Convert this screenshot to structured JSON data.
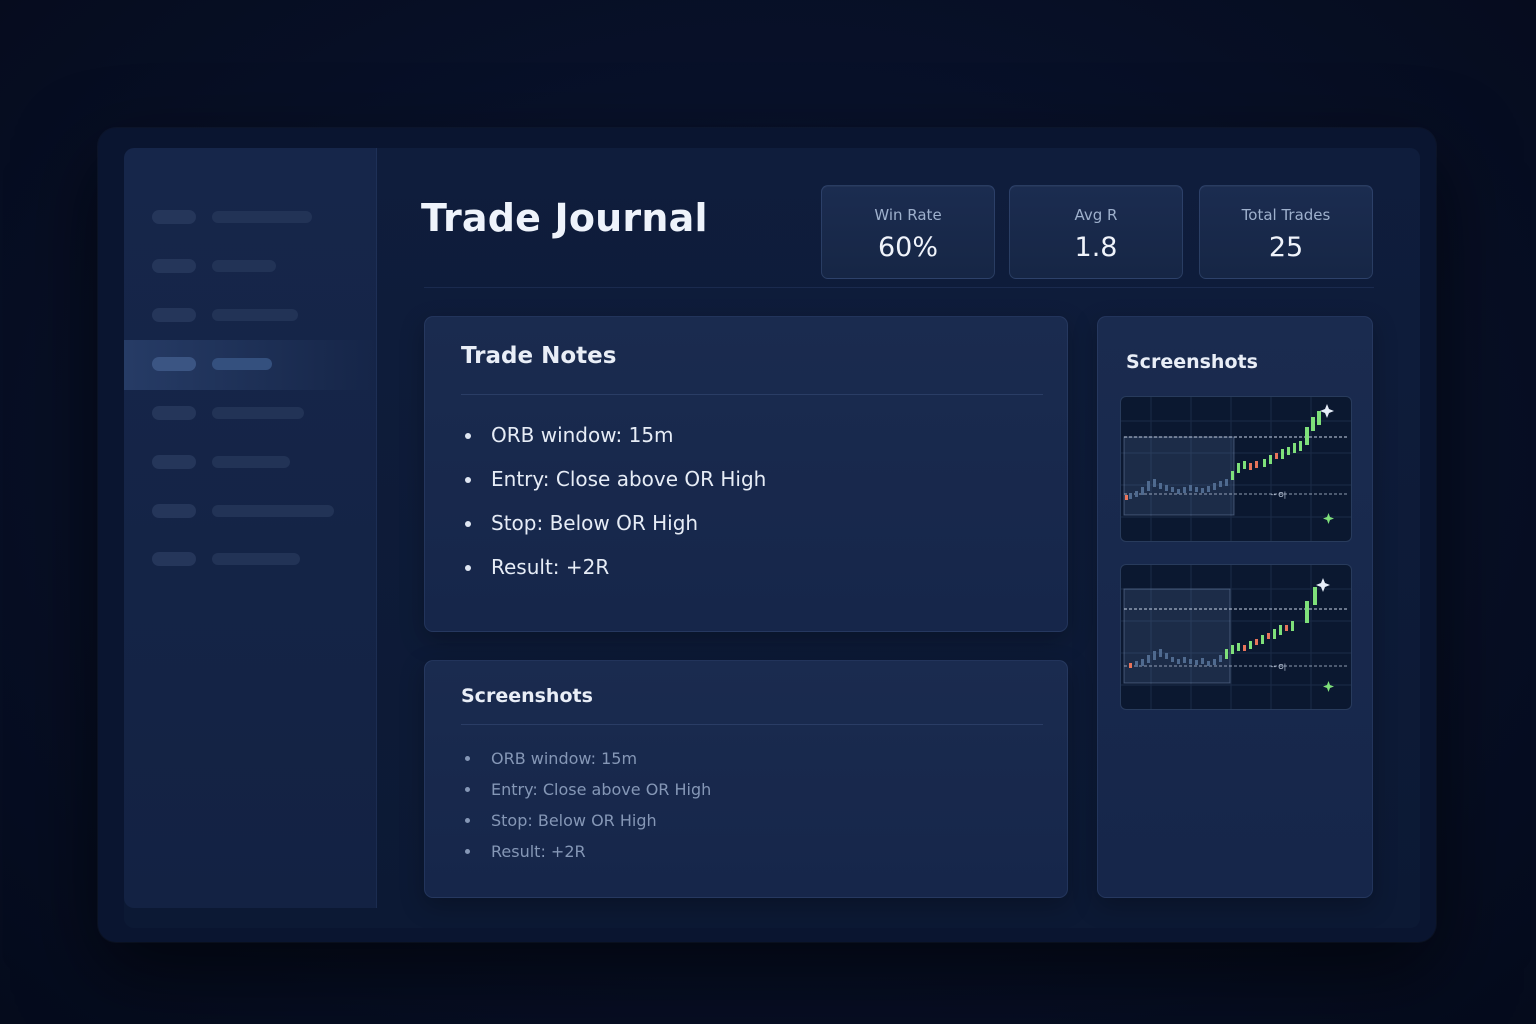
{
  "app": {
    "title": "Trade Journal"
  },
  "stats": [
    {
      "label": "Win Rate",
      "value": "60%"
    },
    {
      "label": "Avg R",
      "value": "1.8"
    },
    {
      "label": "Total Trades",
      "value": "25"
    }
  ],
  "notes_card": {
    "title": "Trade Notes",
    "items": [
      "ORB window: 15m",
      "Entry: Close above OR High",
      "Stop: Below OR High",
      "Result: +2R"
    ]
  },
  "screenshots_card": {
    "title": "Screenshots",
    "items": [
      "ORB window: 15m",
      "Entry: Close above OR High",
      "Stop: Below OR High",
      "Result: +2R"
    ]
  },
  "side_panel": {
    "title": "Screenshots"
  },
  "colors": {
    "bull": "#7fe07a",
    "bear": "#e8745a",
    "accent": "#3b5583"
  },
  "icons": [
    "candlestick-chart-icon",
    "sparkle-icon"
  ]
}
